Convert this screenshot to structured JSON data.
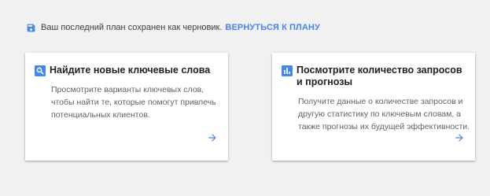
{
  "draft_bar": {
    "message": "Ваш последний план сохранен как черновик.",
    "link_label": "ВЕРНУТЬСЯ К ПЛАНУ"
  },
  "cards": [
    {
      "title": "Найдите новые ключевые слова",
      "description": "Просмотрите варианты ключевых слов, чтобы найти те, которые помогут привлечь потенциальных клиентов.",
      "icon": "search-icon"
    },
    {
      "title": "Посмотрите количество запросов и прогнозы",
      "description": "Получите данные о количестве запросов и другую статистику по ключевым словам, а также прогнозы их будущей эффективности.",
      "icon": "bar-chart-icon"
    }
  ],
  "colors": {
    "accent": "#4285f4",
    "background": "#f1f1f1"
  }
}
